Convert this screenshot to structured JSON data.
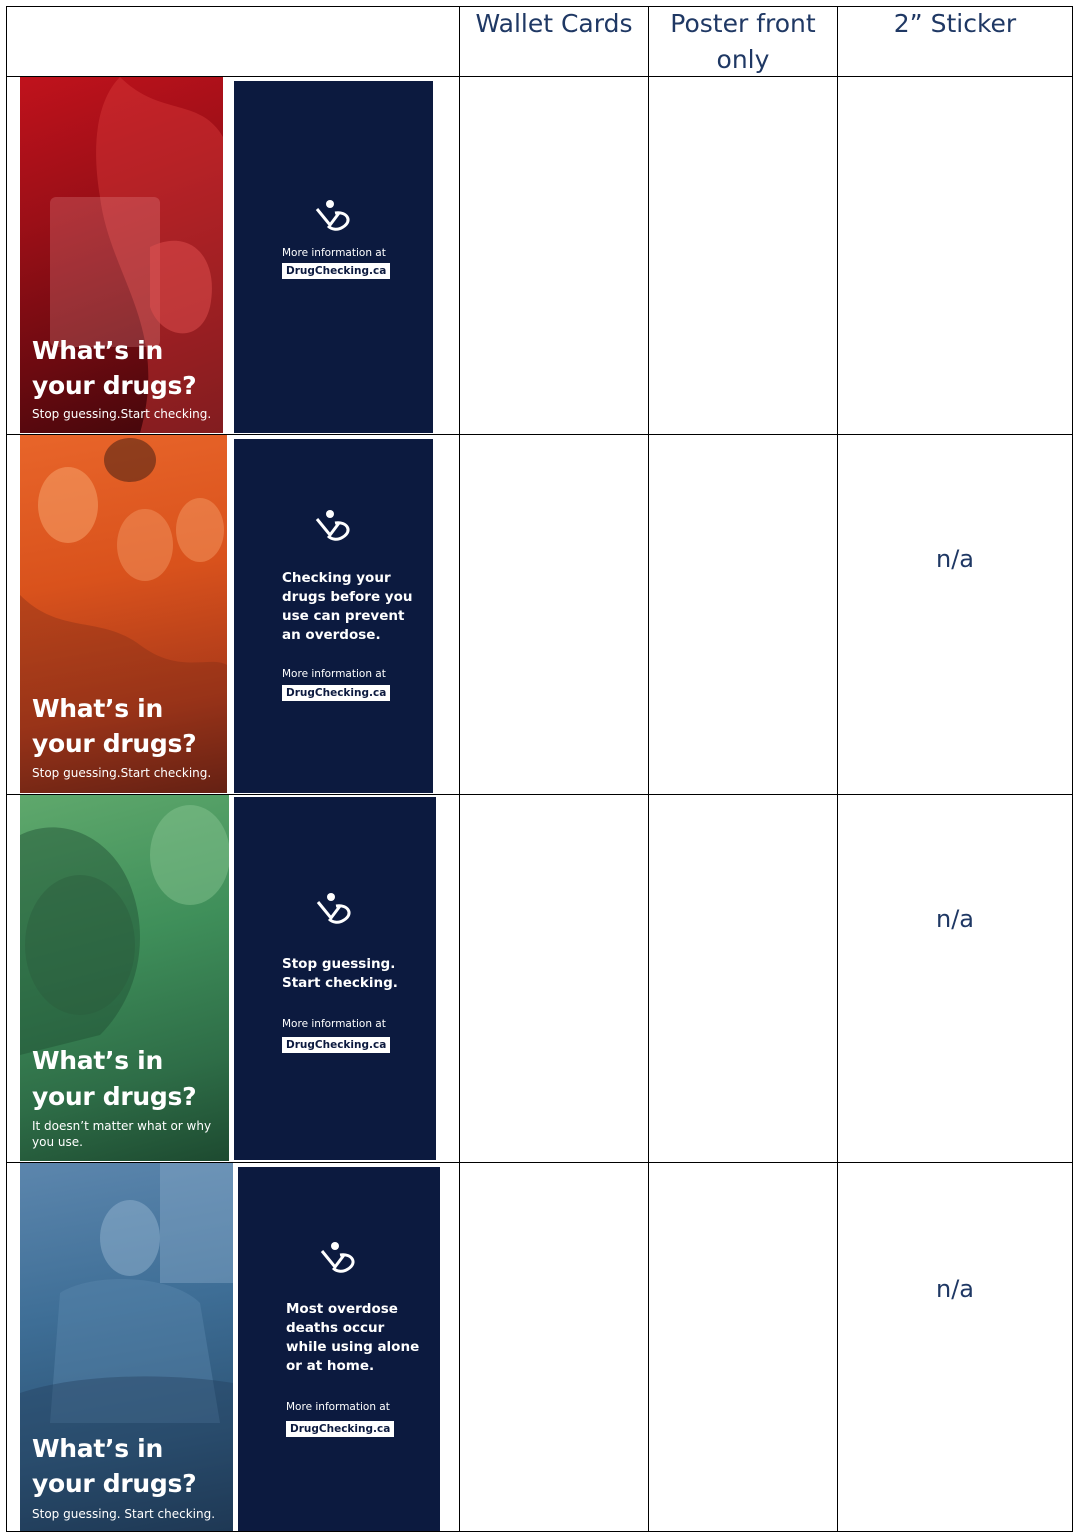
{
  "table": {
    "headers": [
      "",
      "Wallet Cards",
      "Poster front\nonly",
      "2” Sticker"
    ],
    "rows": [
      {
        "front": {
          "headline_line1": "What’s in",
          "headline_line2": "your drugs?",
          "tagline": "Stop guessing.Start checking."
        },
        "back": {
          "message": "",
          "more_info": "More information at",
          "site": "DrugChecking.ca"
        },
        "sticker": ""
      },
      {
        "front": {
          "headline_line1": "What’s in",
          "headline_line2": "your drugs?",
          "tagline": "Stop guessing.Start checking."
        },
        "back": {
          "message": "Checking your drugs before you use can prevent an overdose.",
          "more_info": "More information at",
          "site": "DrugChecking.ca"
        },
        "sticker": "n/a"
      },
      {
        "front": {
          "headline_line1": "What’s in",
          "headline_line2": "your drugs?",
          "tagline": "It doesn’t matter what or why you use."
        },
        "back": {
          "message": "Stop guessing. Start checking.",
          "more_info": "More information at",
          "site": "DrugChecking.ca"
        },
        "sticker": "n/a"
      },
      {
        "front": {
          "headline_line1": "What’s in",
          "headline_line2": "your drugs?",
          "tagline": "Stop guessing. Start checking."
        },
        "back": {
          "message": "Most overdose deaths occur while using alone or at home.",
          "more_info": "More information at",
          "site": "DrugChecking.ca"
        },
        "sticker": "n/a"
      }
    ]
  },
  "colors": {
    "header_text": "#1f3864",
    "card_back": "#0c1a3f",
    "row1_tint": "#b3121b",
    "row2_tint": "#d9521c",
    "row3_tint": "#3f8f5a",
    "row4_tint": "#3e6e96"
  },
  "icons": [
    "drugchecking-logo-icon"
  ]
}
